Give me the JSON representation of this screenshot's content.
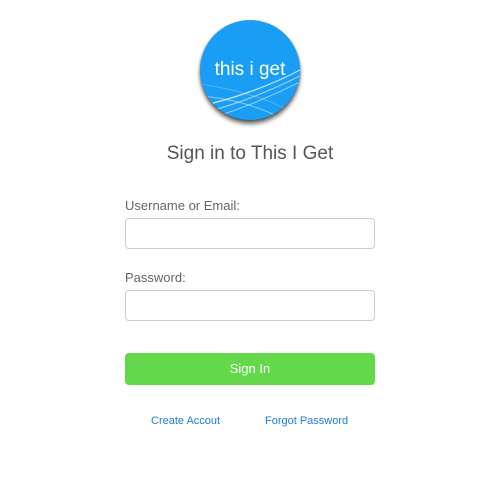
{
  "logo": {
    "text": "this i get",
    "color": "#1a9ef5"
  },
  "title": "Sign in to This I Get",
  "form": {
    "username_label": "Username or Email:",
    "username_value": "",
    "password_label": "Password:",
    "password_value": "",
    "submit_label": "Sign In",
    "submit_color": "#62d84a"
  },
  "links": {
    "create_account": "Create Accout",
    "forgot_password": "Forgot Password"
  },
  "colors": {
    "link": "#1a7fd6"
  }
}
